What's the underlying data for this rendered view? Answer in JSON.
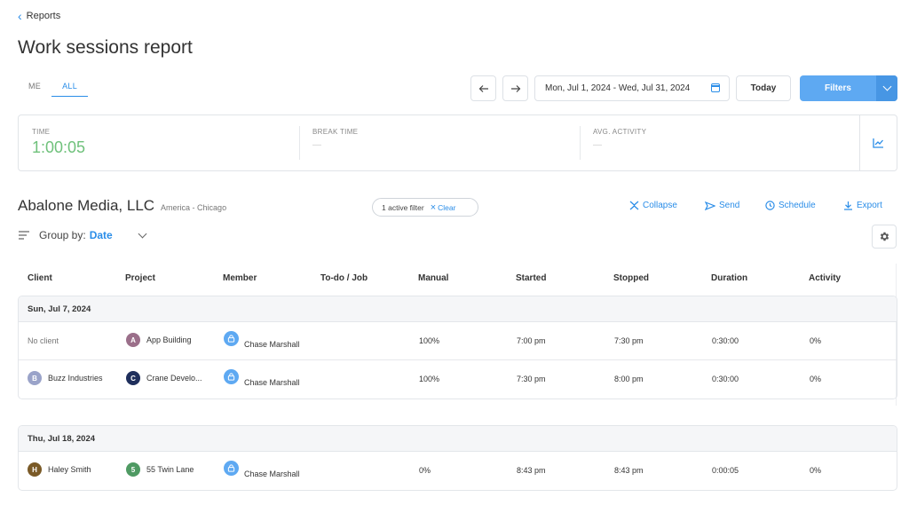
{
  "breadcrumb": {
    "back_label": "Reports"
  },
  "page": {
    "title": "Work sessions report"
  },
  "scope_tabs": [
    {
      "label": "ME",
      "active": false
    },
    {
      "label": "ALL",
      "active": true
    }
  ],
  "toolbar": {
    "prev_icon": "arrow-left-icon",
    "next_icon": "arrow-right-icon",
    "date_range": "Mon, Jul 1, 2024 - Wed, Jul 31, 2024",
    "today_label": "Today",
    "filters_label": "Filters"
  },
  "summary": {
    "time_label": "TIME",
    "time_value": "1:00:05",
    "break_label": "BREAK TIME",
    "break_value": "—",
    "activity_label": "AVG. ACTIVITY",
    "activity_value": "—"
  },
  "org": {
    "name": "Abalone Media, LLC",
    "timezone": "America - Chicago"
  },
  "filter_pill": {
    "text": "1 active filter",
    "clear_label": "Clear"
  },
  "actions": {
    "collapse": "Collapse",
    "send": "Send",
    "schedule": "Schedule",
    "export": "Export"
  },
  "group_by": {
    "label": "Group by:",
    "value": "Date"
  },
  "table": {
    "columns": [
      "Client",
      "Project",
      "Member",
      "To-do / Job",
      "Manual",
      "Started",
      "Stopped",
      "Duration",
      "Activity"
    ],
    "days": [
      {
        "date": "Sun, Jul 7, 2024",
        "rows": [
          {
            "client": "No client",
            "client_initial": "",
            "project": "App Building",
            "project_initial": "A",
            "member": "Chase Marshall",
            "todo": "",
            "manual": "100%",
            "started": "7:00 pm",
            "stopped": "7:30 pm",
            "duration": "0:30:00",
            "activity": "0%"
          },
          {
            "client": "Buzz Industries",
            "client_initial": "B",
            "project": "Crane Develo...",
            "project_initial": "C",
            "member": "Chase Marshall",
            "todo": "",
            "manual": "100%",
            "started": "7:30 pm",
            "stopped": "8:00 pm",
            "duration": "0:30:00",
            "activity": "0%"
          }
        ]
      },
      {
        "date": "Thu, Jul 18, 2024",
        "rows": [
          {
            "client": "Haley Smith",
            "client_initial": "H",
            "project": "55 Twin Lane",
            "project_initial": "5",
            "member": "Chase Marshall",
            "todo": "",
            "manual": "0%",
            "started": "8:43 pm",
            "stopped": "8:43 pm",
            "duration": "0:00:05",
            "activity": "0%"
          }
        ]
      }
    ]
  },
  "colors": {
    "accent": "#2a8de8",
    "time_green": "#6fc17b",
    "avatar_app_building": "#9b6f8a",
    "avatar_buzz": "#9aa3c9",
    "avatar_crane": "#1f2f5c",
    "avatar_haley": "#7a5a27",
    "avatar_55_twin": "#4f9a63",
    "avatar_member": "#5ea9f2"
  }
}
